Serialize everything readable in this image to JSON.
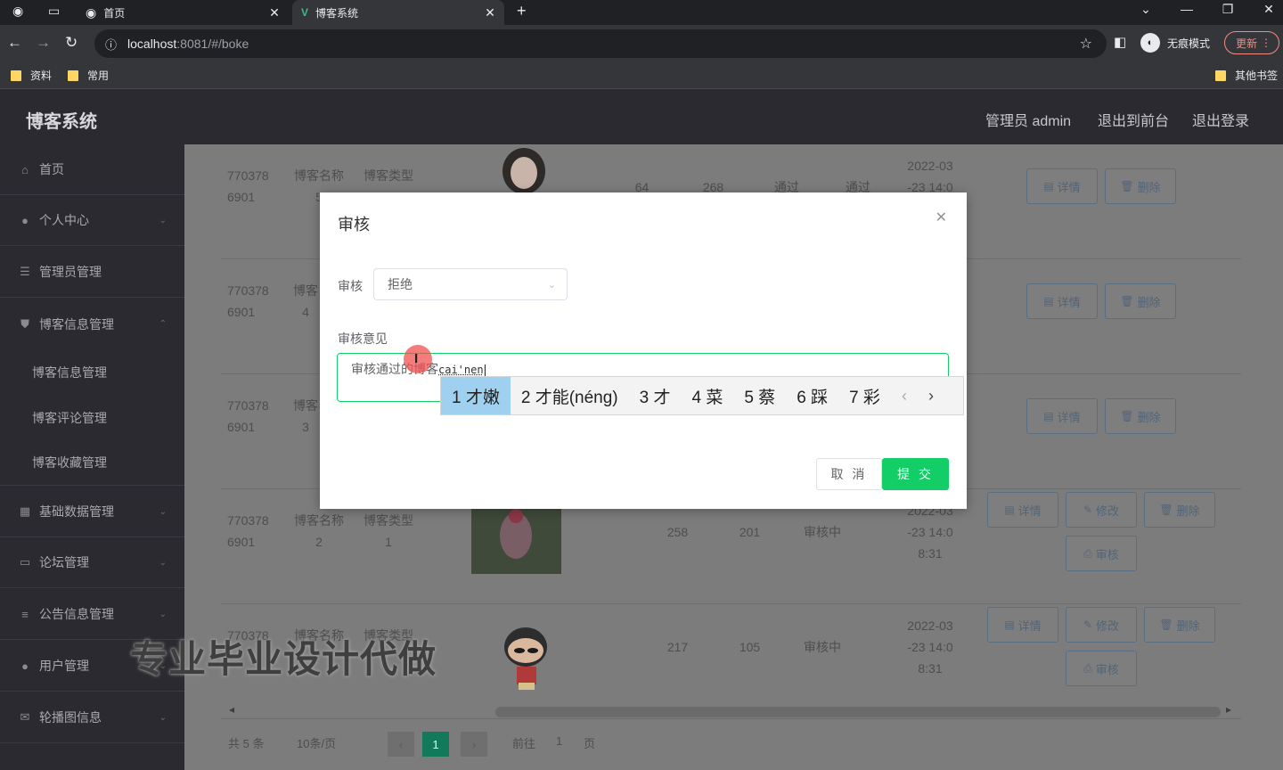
{
  "browser": {
    "tabs": [
      {
        "title": "首页",
        "active": false
      },
      {
        "title": "博客系统",
        "active": true
      }
    ],
    "url_host": "localhost",
    "url_rest": ":8081/#/boke",
    "incognito_label": "无痕模式",
    "update_label": "更新",
    "bookmarks": [
      "资料",
      "常用"
    ],
    "other_bookmarks": "其他书签"
  },
  "app": {
    "title": "博客系统",
    "header_links": [
      "管理员 admin",
      "退出到前台",
      "退出登录"
    ]
  },
  "sidebar": {
    "items": [
      {
        "label": "首页",
        "icon": "home-icon",
        "expandable": false
      },
      {
        "label": "个人中心",
        "icon": "user-icon",
        "expandable": true
      },
      {
        "label": "管理员管理",
        "icon": "list-icon",
        "expandable": false
      },
      {
        "label": "博客信息管理",
        "icon": "shield-icon",
        "expandable": true
      },
      {
        "label": "基础数据管理",
        "icon": "grid-icon",
        "expandable": true
      },
      {
        "label": "论坛管理",
        "icon": "chat-icon",
        "expandable": true
      },
      {
        "label": "公告信息管理",
        "icon": "menu-icon",
        "expandable": true
      },
      {
        "label": "用户管理",
        "icon": "user-shield-icon",
        "expandable": true
      },
      {
        "label": "轮播图信息",
        "icon": "mail-icon",
        "expandable": true
      }
    ],
    "subitems": [
      "博客信息管理",
      "博客评论管理",
      "博客收藏管理"
    ]
  },
  "table": {
    "rows": [
      {
        "id1": "770378",
        "id2": "6901",
        "name": "博客名称",
        "name2": "5",
        "type": "博客类型",
        "type2": "",
        "likes": "64",
        "dislikes": "268",
        "status1": "通过",
        "status2": "通过",
        "date1": "2022-03",
        "date2": "-23 14:0",
        "date3": "",
        "buttons": [
          "详情",
          "删除"
        ]
      },
      {
        "id1": "770378",
        "id2": "6901",
        "name": "博客",
        "name2": "4",
        "type": "",
        "type2": "",
        "likes": "",
        "dislikes": "",
        "status1": "",
        "status2": "",
        "date1": "",
        "date2": "",
        "date3": "",
        "buttons": [
          "详情",
          "删除"
        ]
      },
      {
        "id1": "770378",
        "id2": "6901",
        "name": "博客",
        "name2": "3",
        "type": "",
        "type2": "",
        "likes": "",
        "dislikes": "",
        "status1": "",
        "status2": "",
        "date1": "",
        "date2": "",
        "date3": "",
        "buttons": [
          "详情",
          "删除"
        ]
      },
      {
        "id1": "770378",
        "id2": "6901",
        "name": "博客名称",
        "name2": "2",
        "type": "博客类型",
        "type2": "1",
        "likes": "258",
        "dislikes": "201",
        "status1": "审核中",
        "status2": "",
        "date1": "2022-03",
        "date2": "-23 14:0",
        "date3": "8:31",
        "buttons": [
          "详情",
          "修改",
          "删除",
          "审核"
        ]
      },
      {
        "id1": "770378",
        "id2": "",
        "name": "博客名称",
        "name2": "",
        "type": "博客类型",
        "type2": "",
        "likes": "217",
        "dislikes": "105",
        "status1": "审核中",
        "status2": "",
        "date1": "2022-03",
        "date2": "-23 14:0",
        "date3": "8:31",
        "buttons": [
          "详情",
          "修改",
          "删除",
          "审核"
        ]
      }
    ]
  },
  "pagination": {
    "total": "共 5 条",
    "page_size": "10条/页",
    "current": "1",
    "goto_prefix": "前往",
    "goto_value": "1",
    "goto_suffix": "页"
  },
  "watermark": "专业毕业设计代做",
  "dialog": {
    "title": "审核",
    "audit_label": "审核",
    "audit_value": "拒绝",
    "opinion_label": "审核意见",
    "opinion_text": "审核通过的博客",
    "opinion_pinyin": "cai'nen",
    "cancel_label": "取 消",
    "submit_label": "提 交"
  },
  "ime": {
    "candidates": [
      "1 才嫩",
      "2 才能(néng)",
      "3 才",
      "4 菜",
      "5 蔡",
      "6 踩",
      "7 彩"
    ],
    "selected_index": 0
  },
  "colors": {
    "accent": "#13ce66",
    "pagination_current": "#13795b",
    "sidebar_bg": "#2a2a30"
  }
}
